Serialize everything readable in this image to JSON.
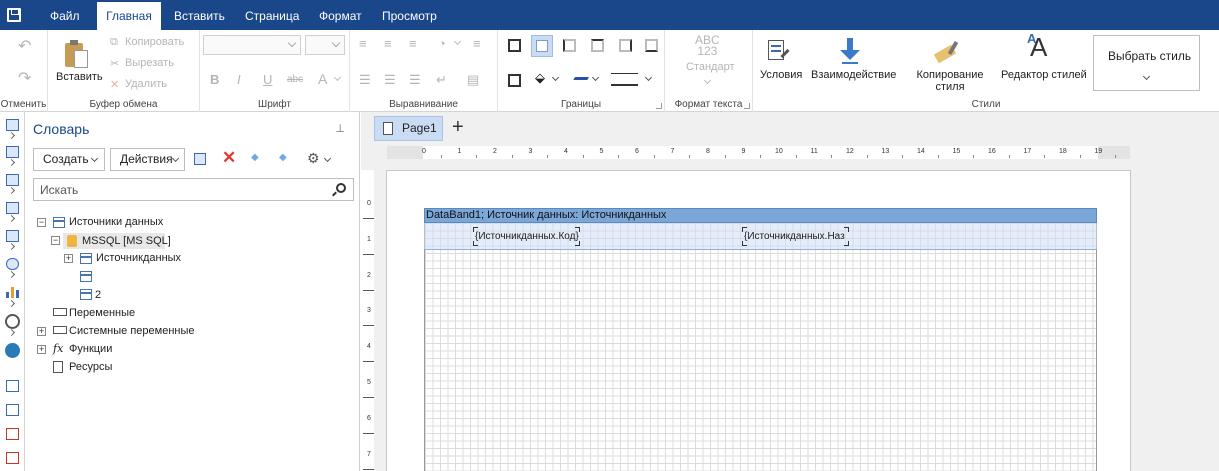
{
  "menu": {
    "tabs": [
      {
        "label": "Файл",
        "active": false
      },
      {
        "label": "Главная",
        "active": true
      },
      {
        "label": "Вставить",
        "active": false
      },
      {
        "label": "Страница",
        "active": false
      },
      {
        "label": "Формат",
        "active": false
      },
      {
        "label": "Просмотр",
        "active": false
      }
    ]
  },
  "ribbon": {
    "undo_group": {
      "label": "Отменить"
    },
    "clipboard": {
      "label": "Буфер обмена",
      "paste": "Вставить",
      "copy": "Копировать",
      "cut": "Вырезать",
      "delete": "Удалить"
    },
    "font": {
      "label": "Шрифт",
      "bold": "B",
      "italic": "I",
      "underline": "U",
      "strike": "abc",
      "color": "A"
    },
    "alignment": {
      "label": "Выравнивание"
    },
    "borders": {
      "label": "Границы"
    },
    "text_format": {
      "label": "Формат текста",
      "sample": "ABC\n123",
      "sample_line1": "ABC",
      "sample_line2": "123",
      "standard": "Стандарт"
    },
    "styles": {
      "label": "Стили",
      "conditions": "Условия",
      "interaction": "Взаимодействие",
      "copy_style_line1": "Копирование",
      "copy_style_line2": "стиля",
      "style_editor": "Редактор стилей",
      "choose_style": "Выбрать стиль"
    }
  },
  "dictionary": {
    "title": "Словарь",
    "create_button": "Создать",
    "actions_button": "Действия",
    "search_placeholder": "Искать",
    "tree": {
      "data_sources": "Источники данных",
      "connection": "MSSQL [MS SQL]",
      "table1": "Источникданных",
      "table2": "",
      "table3": "2",
      "variables": "Переменные",
      "system_variables": "Системные переменные",
      "functions": "Функции",
      "functions_icon": "fx",
      "resources": "Ресурсы"
    }
  },
  "designer": {
    "page_tab": "Page1",
    "add_page": "+",
    "ruler_h": [
      "0",
      "1",
      "2",
      "3",
      "4",
      "5",
      "6",
      "7",
      "8",
      "9",
      "10",
      "11",
      "12",
      "13",
      "14",
      "15",
      "16",
      "17",
      "18",
      "19"
    ],
    "ruler_v": [
      "0",
      "1",
      "2",
      "3",
      "4",
      "5",
      "6",
      "7"
    ],
    "band": {
      "header": "DataBand1; Источник данных: Источникданных",
      "field1": "{Источникданных.Код}",
      "field2": "{Источникданных.Наз"
    }
  },
  "colors": {
    "topbar": "#19478a",
    "band_header": "#7aa6d8",
    "accent_blue": "#3a6ab0",
    "delete_red": "#e03c31"
  }
}
